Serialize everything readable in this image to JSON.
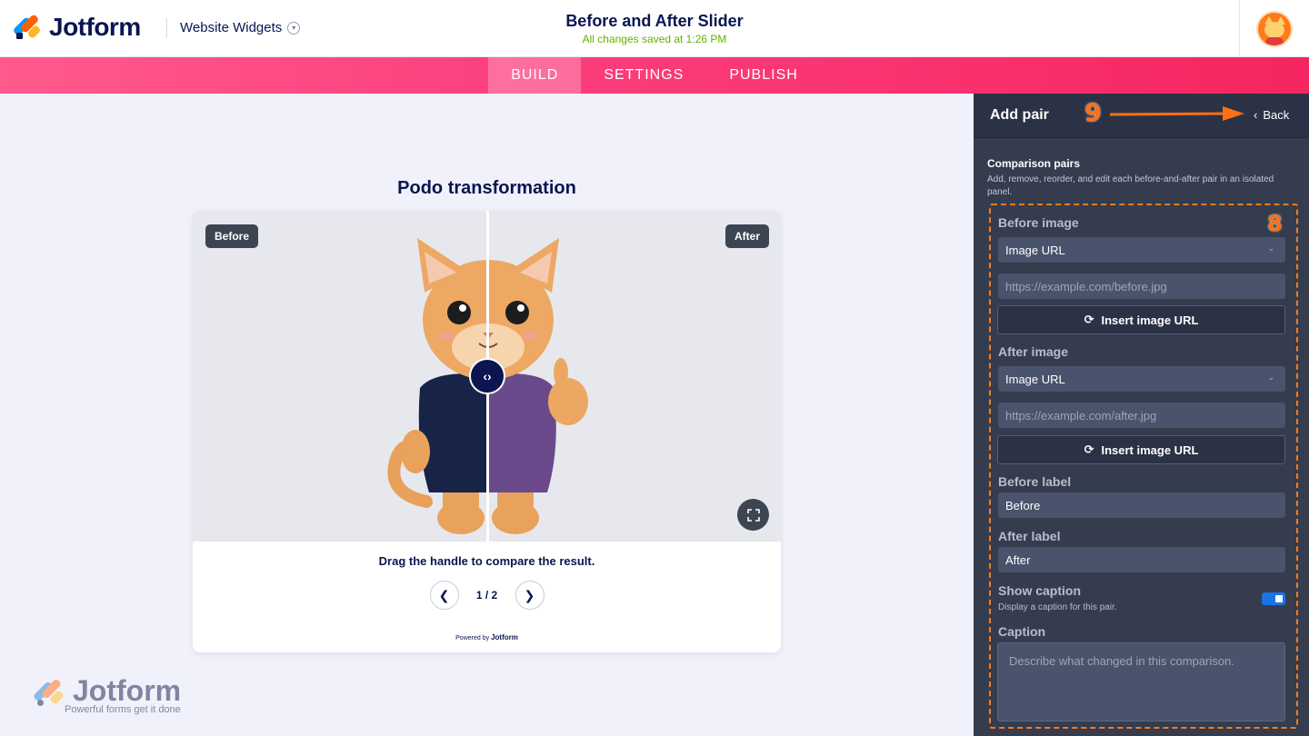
{
  "header": {
    "brand": "Jotform",
    "workspace": "Website Widgets",
    "title": "Before and After Slider",
    "save_status": "All changes saved at 1:26 PM"
  },
  "nav": {
    "tabs": [
      {
        "label": "BUILD",
        "active": true
      },
      {
        "label": "SETTINGS",
        "active": false
      },
      {
        "label": "PUBLISH",
        "active": false
      }
    ]
  },
  "preview": {
    "title": "Podo transformation",
    "before_badge": "Before",
    "after_badge": "After",
    "hint": "Drag the handle to compare the result.",
    "pager": "1 / 2",
    "powered_by": "Powered by",
    "powered_brand": "Jotform"
  },
  "watermark": {
    "brand": "Jotform",
    "tagline": "Powerful forms get it done"
  },
  "panel": {
    "title": "Add pair",
    "annotation_9": "9",
    "back_label": "Back",
    "section_title": "Comparison pairs",
    "section_desc": "Add, remove, reorder, and edit each before-and-after pair in an isolated panel.",
    "annotation_8": "8",
    "before_image": {
      "label": "Before image",
      "source": "Image URL",
      "url_placeholder": "https://example.com/before.jpg",
      "insert_label": "Insert image URL"
    },
    "after_image": {
      "label": "After image",
      "source": "Image URL",
      "url_placeholder": "https://example.com/after.jpg",
      "insert_label": "Insert image URL"
    },
    "before_label": {
      "label": "Before label",
      "value": "Before"
    },
    "after_label": {
      "label": "After label",
      "value": "After"
    },
    "show_caption": {
      "label": "Show caption",
      "desc": "Display a caption for this pair.",
      "on": true
    },
    "caption": {
      "label": "Caption",
      "placeholder": "Describe what changed in this comparison."
    }
  },
  "colors": {
    "accent": "#fc3f7d",
    "panel_bg": "#343c4e",
    "annotation": "#ff6f14",
    "toggle": "#1a73e8",
    "save_status": "#64b200"
  }
}
